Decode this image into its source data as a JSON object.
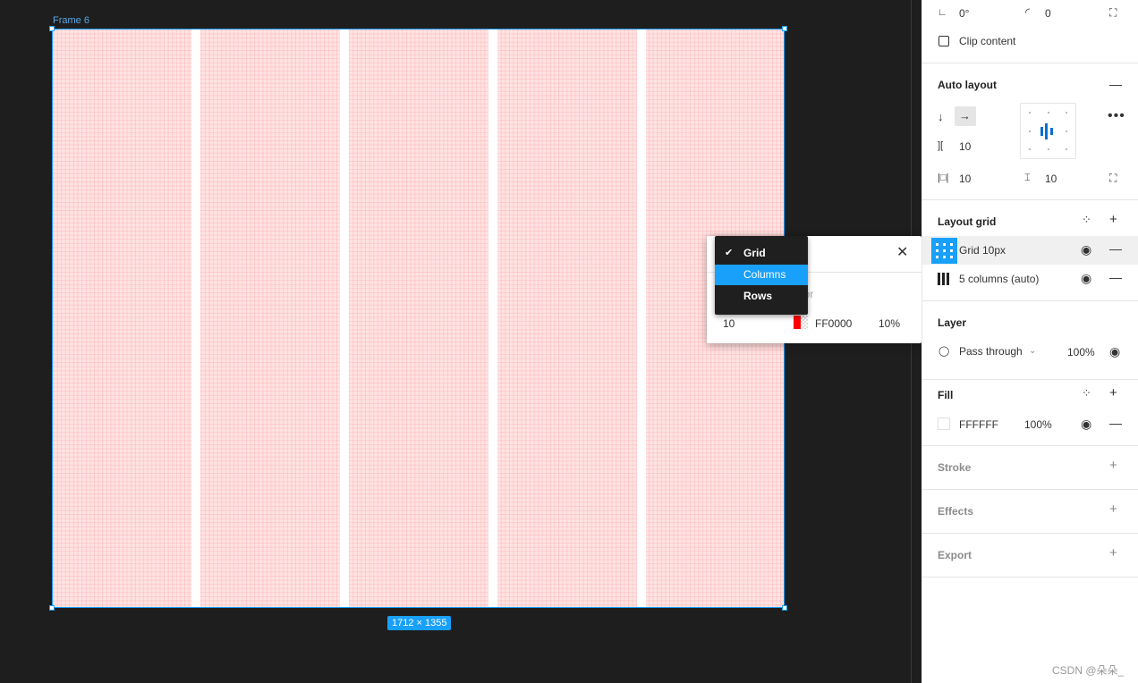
{
  "canvas": {
    "frame_label": "Frame 6",
    "size_badge": "1712 × 1355",
    "columns": 5
  },
  "panel": {
    "rotation": "0°",
    "corner_radius": "0",
    "clip_content_label": "Clip content",
    "auto_layout": {
      "title": "Auto layout",
      "spacing": "10",
      "padding_horizontal": "10",
      "padding_vertical": "10"
    },
    "layout_grid": {
      "title": "Layout grid",
      "items": [
        {
          "label": "Grid 10px"
        },
        {
          "label": "5 columns (auto)"
        }
      ]
    },
    "layer": {
      "title": "Layer",
      "blend_mode": "Pass through",
      "opacity": "100%"
    },
    "fill": {
      "title": "Fill",
      "hex": "FFFFFF",
      "opacity": "100%"
    },
    "stroke_title": "Stroke",
    "effects_title": "Effects",
    "export_title": "Export"
  },
  "popup": {
    "menu_items": [
      "Grid",
      "Columns",
      "Rows"
    ],
    "selected_item": "Grid",
    "hover_item": "Columns",
    "color_label_partial": "lor",
    "size_value": "10",
    "color_hex": "FF0000",
    "color_opacity": "10%"
  },
  "colors": {
    "accent": "#18a0fb",
    "grid_color": "#ff0000",
    "canvas_bg": "#1e1e1e"
  },
  "watermark": "CSDN @朵朵_"
}
